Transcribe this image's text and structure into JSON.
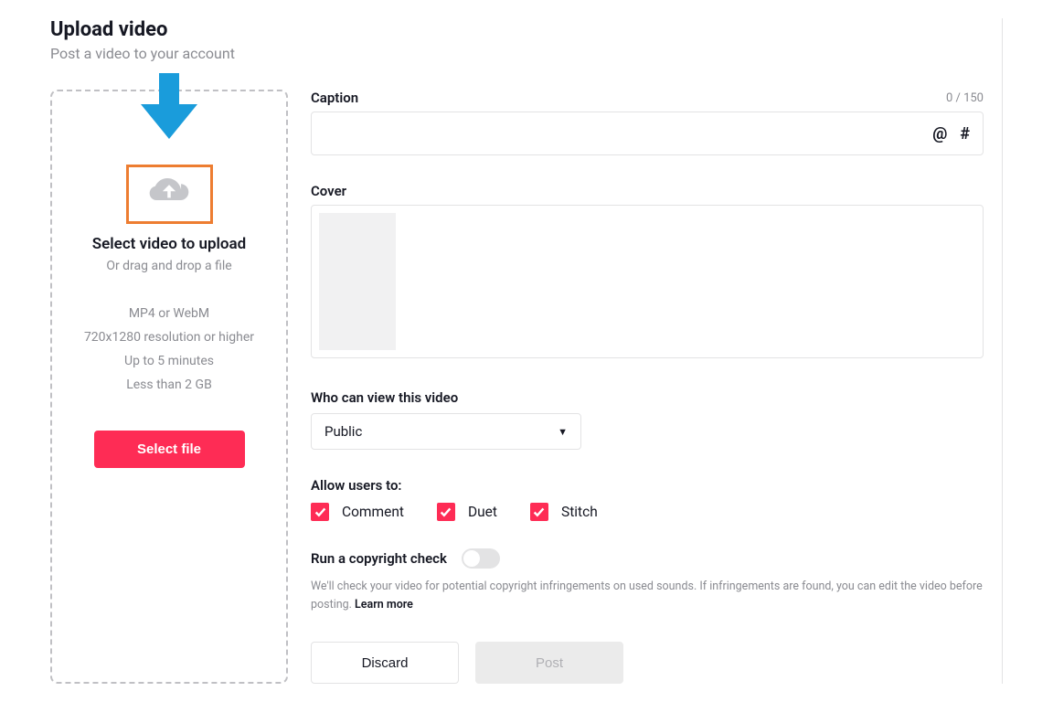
{
  "header": {
    "title": "Upload video",
    "subtitle": "Post a video to your account"
  },
  "upload_panel": {
    "title": "Select video to upload",
    "subtitle": "Or drag and drop a file",
    "requirements": [
      "MP4 or WebM",
      "720x1280 resolution or higher",
      "Up to 5 minutes",
      "Less than 2 GB"
    ],
    "button_label": "Select file"
  },
  "caption": {
    "label": "Caption",
    "char_count": "0 / 150",
    "value": "",
    "mention_icon": "@",
    "hashtag_icon": "#"
  },
  "cover": {
    "label": "Cover"
  },
  "privacy": {
    "label": "Who can view this video",
    "selected": "Public"
  },
  "allow": {
    "label": "Allow users to:",
    "options": [
      {
        "key": "comment",
        "label": "Comment",
        "checked": true
      },
      {
        "key": "duet",
        "label": "Duet",
        "checked": true
      },
      {
        "key": "stitch",
        "label": "Stitch",
        "checked": true
      }
    ]
  },
  "copyright": {
    "label": "Run a copyright check",
    "enabled": false,
    "description_prefix": "We'll check your video for potential copyright infringements on used sounds. If infringements are found, you can edit the video before posting. ",
    "learn_more": "Learn more"
  },
  "actions": {
    "discard": "Discard",
    "post": "Post"
  }
}
